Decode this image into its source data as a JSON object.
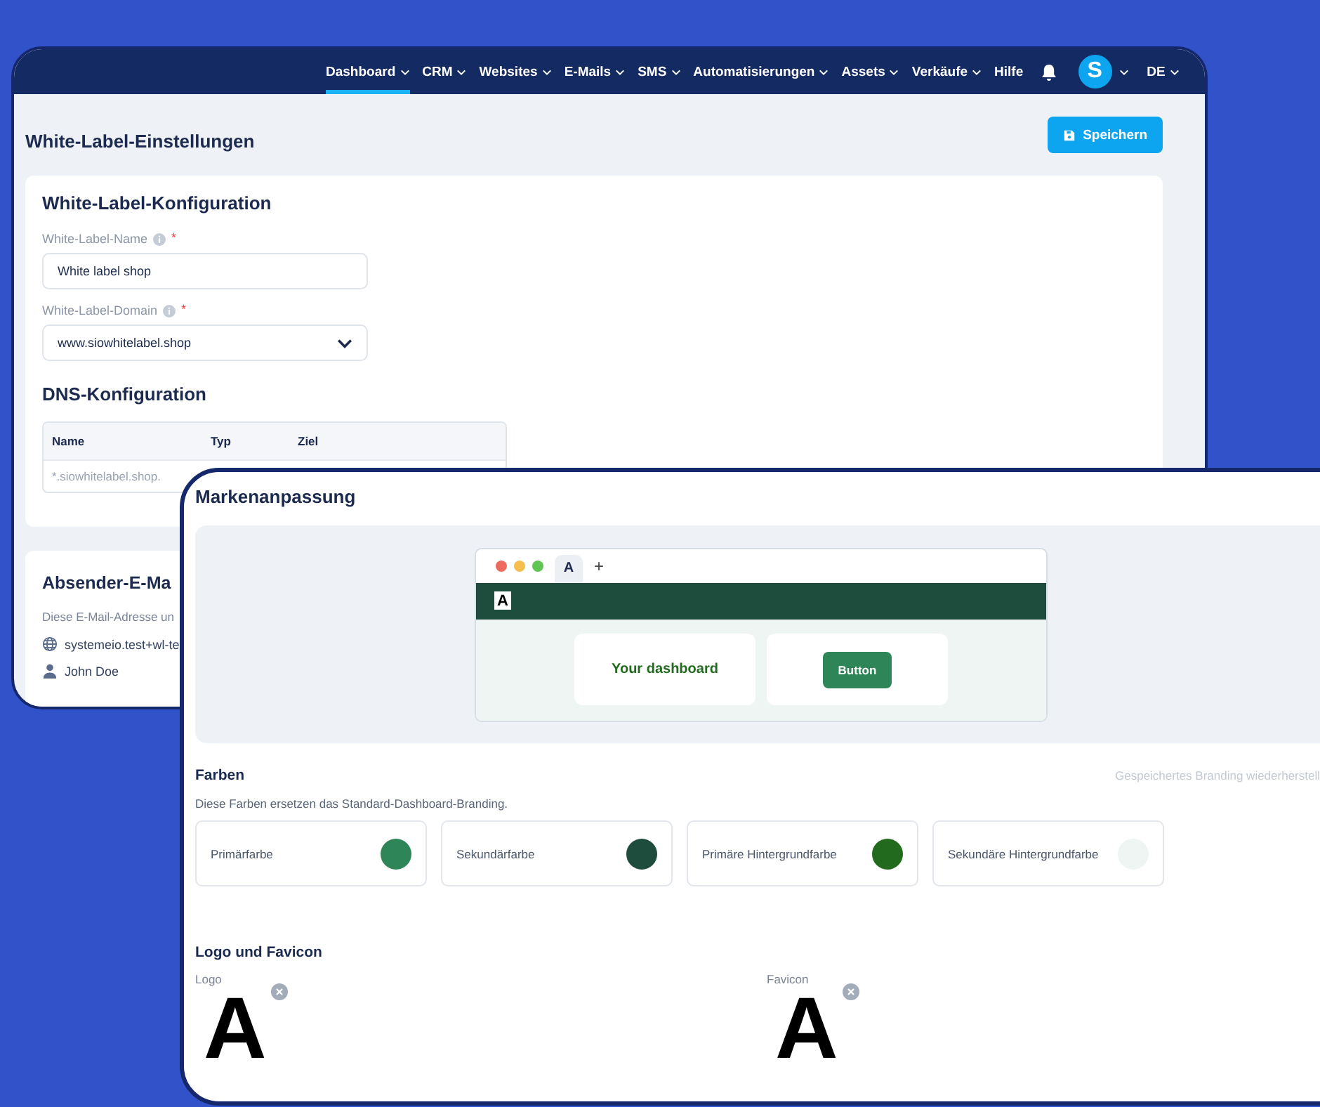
{
  "back_window": {
    "nav": {
      "items": [
        {
          "label": "Dashboard",
          "dropdown": true,
          "selected": true
        },
        {
          "label": "CRM",
          "dropdown": true,
          "selected": false
        },
        {
          "label": "Websites",
          "dropdown": true,
          "selected": false
        },
        {
          "label": "E-Mails",
          "dropdown": true,
          "selected": false
        },
        {
          "label": "SMS",
          "dropdown": true,
          "selected": false
        },
        {
          "label": "Automatisierungen",
          "dropdown": true,
          "selected": false
        },
        {
          "label": "Assets",
          "dropdown": true,
          "selected": false
        },
        {
          "label": "Verkäufe",
          "dropdown": true,
          "selected": false
        },
        {
          "label": "Hilfe",
          "dropdown": false,
          "selected": false
        }
      ],
      "avatar_letter": "S",
      "language": "DE"
    },
    "page_title": "White-Label-Einstellungen",
    "save_button": "Speichern",
    "config_card": {
      "title": "White-Label-Konfiguration",
      "fields": [
        {
          "kind": "text",
          "label": "White-Label-Name",
          "required_mark": "*",
          "value": "White label shop"
        },
        {
          "kind": "select",
          "label": "White-Label-Domain",
          "required_mark": "*",
          "value": "www.siowhitelabel.shop"
        }
      ],
      "dns_title": "DNS-Konfiguration",
      "dns_table": {
        "columns": [
          "Name",
          "Typ",
          "Ziel"
        ],
        "rows": [
          [
            "*.siowhitelabel.shop."
          ]
        ]
      }
    },
    "sender_card": {
      "title": "Absender-E-Ma",
      "description": "Diese E-Mail-Adresse un",
      "email": "systemeio.test+wl-te",
      "name": "John Doe"
    }
  },
  "front_window": {
    "title": "Markenanpassung",
    "preview": {
      "tab_logo": "A",
      "new_tab": "+",
      "header_logo": "A",
      "card_text": "Your dashboard",
      "button": "Button"
    },
    "colors_title": "Farben",
    "restore_link": "Gespeichertes Branding wiederherstell",
    "colors_description": "Diese Farben ersetzen das Standard-Dashboard-Branding.",
    "colors": [
      {
        "label": "Primärfarbe",
        "color": "#2e8558"
      },
      {
        "label": "Sekundärfarbe",
        "color": "#1e4d3e"
      },
      {
        "label": "Primäre Hintergrundfarbe",
        "color": "#226a1e"
      },
      {
        "label": "Sekundäre Hintergrundfarbe",
        "color": "#eef5f3"
      }
    ],
    "logo_title": "Logo und Favicon",
    "logos": [
      {
        "label": "Logo",
        "glyph": "A"
      },
      {
        "label": "Favicon",
        "glyph": "A"
      }
    ]
  }
}
